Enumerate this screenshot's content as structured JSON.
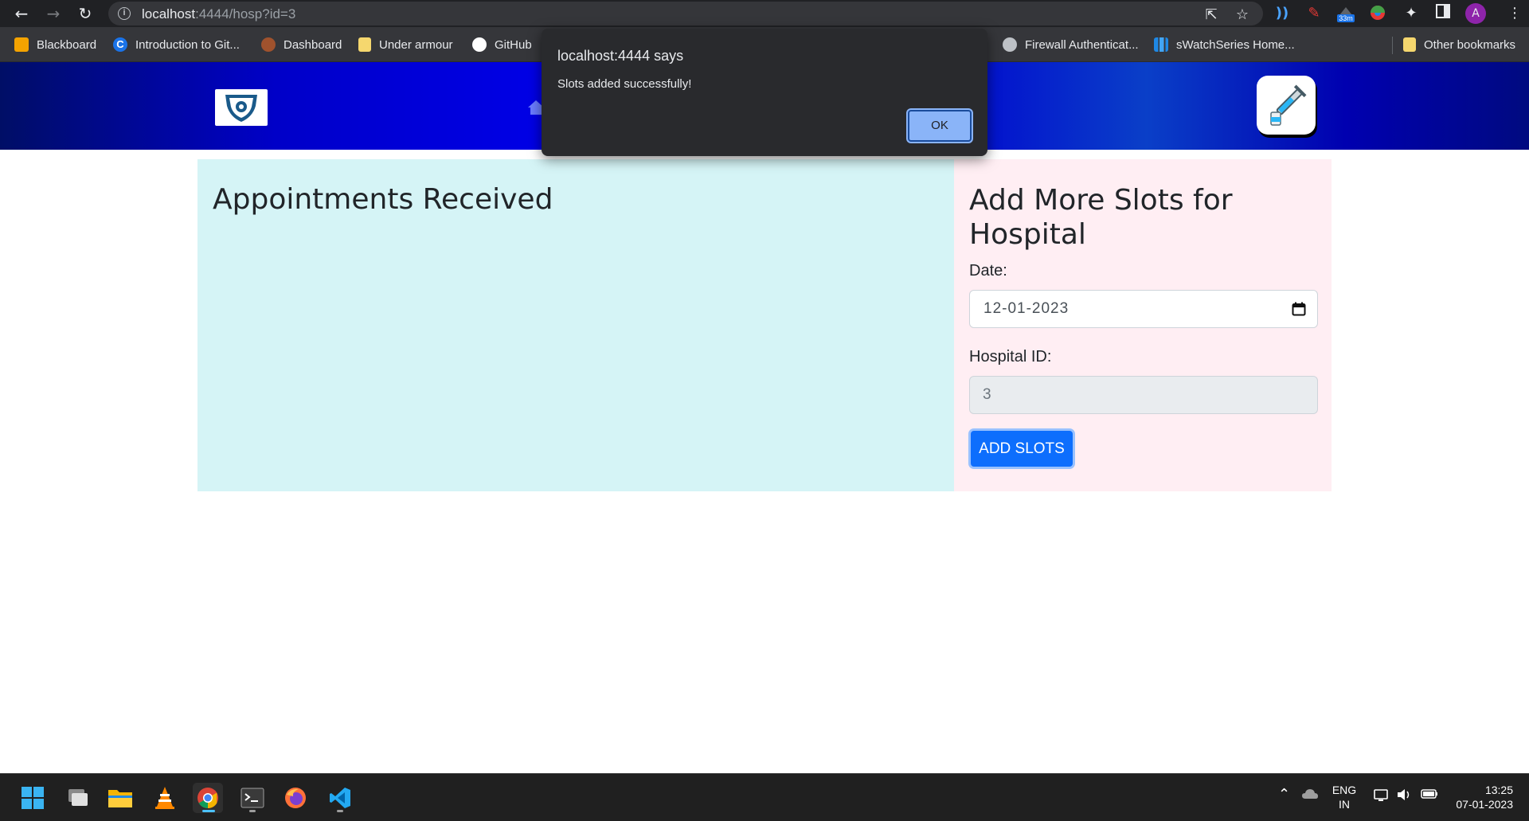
{
  "browser": {
    "url_host": "localhost",
    "url_rest": ":4444/hosp?id=3",
    "profile_initial": "A",
    "extension_badge": "33m"
  },
  "bookmarks": [
    {
      "label": "Blackboard",
      "icon": "blackboard-icon",
      "color": "#f4a300"
    },
    {
      "label": "Introduction to Git...",
      "icon": "c-logo-icon",
      "color": "#1a73e8"
    },
    {
      "label": "Dashboard",
      "icon": "dashboard-icon",
      "color": "#a0522d"
    },
    {
      "label": "Under armour",
      "icon": "folder-icon",
      "color": "#f5d76e"
    },
    {
      "label": "GitHub",
      "icon": "github-icon",
      "color": "#ffffff"
    },
    {
      "label": "Firewall Authenticat...",
      "icon": "globe-icon",
      "color": "#bdc1c6"
    },
    {
      "label": "sWatchSeries Home...",
      "icon": "swatch-icon",
      "color": "#1e88e5"
    },
    {
      "label": "Other bookmarks",
      "icon": "folder-icon",
      "color": "#f5d76e"
    }
  ],
  "main": {
    "left_title": "Appointments Received",
    "right_title": "Add More Slots for Hospital",
    "date_label": "Date:",
    "date_value": "12-01-2023",
    "hospital_label": "Hospital ID:",
    "hospital_value": "3",
    "add_button": "ADD SLOTS"
  },
  "dialog": {
    "title": "localhost:4444 says",
    "message": "Slots added successfully!",
    "ok_label": "OK"
  },
  "taskbar": {
    "lang_top": "ENG",
    "lang_bottom": "IN",
    "time": "13:25",
    "date": "07-01-2023"
  },
  "colors": {
    "header_accent": "#0000ee",
    "left_panel": "#d5f4f6",
    "right_panel": "#ffeef3",
    "primary_button": "#0d6efd"
  }
}
